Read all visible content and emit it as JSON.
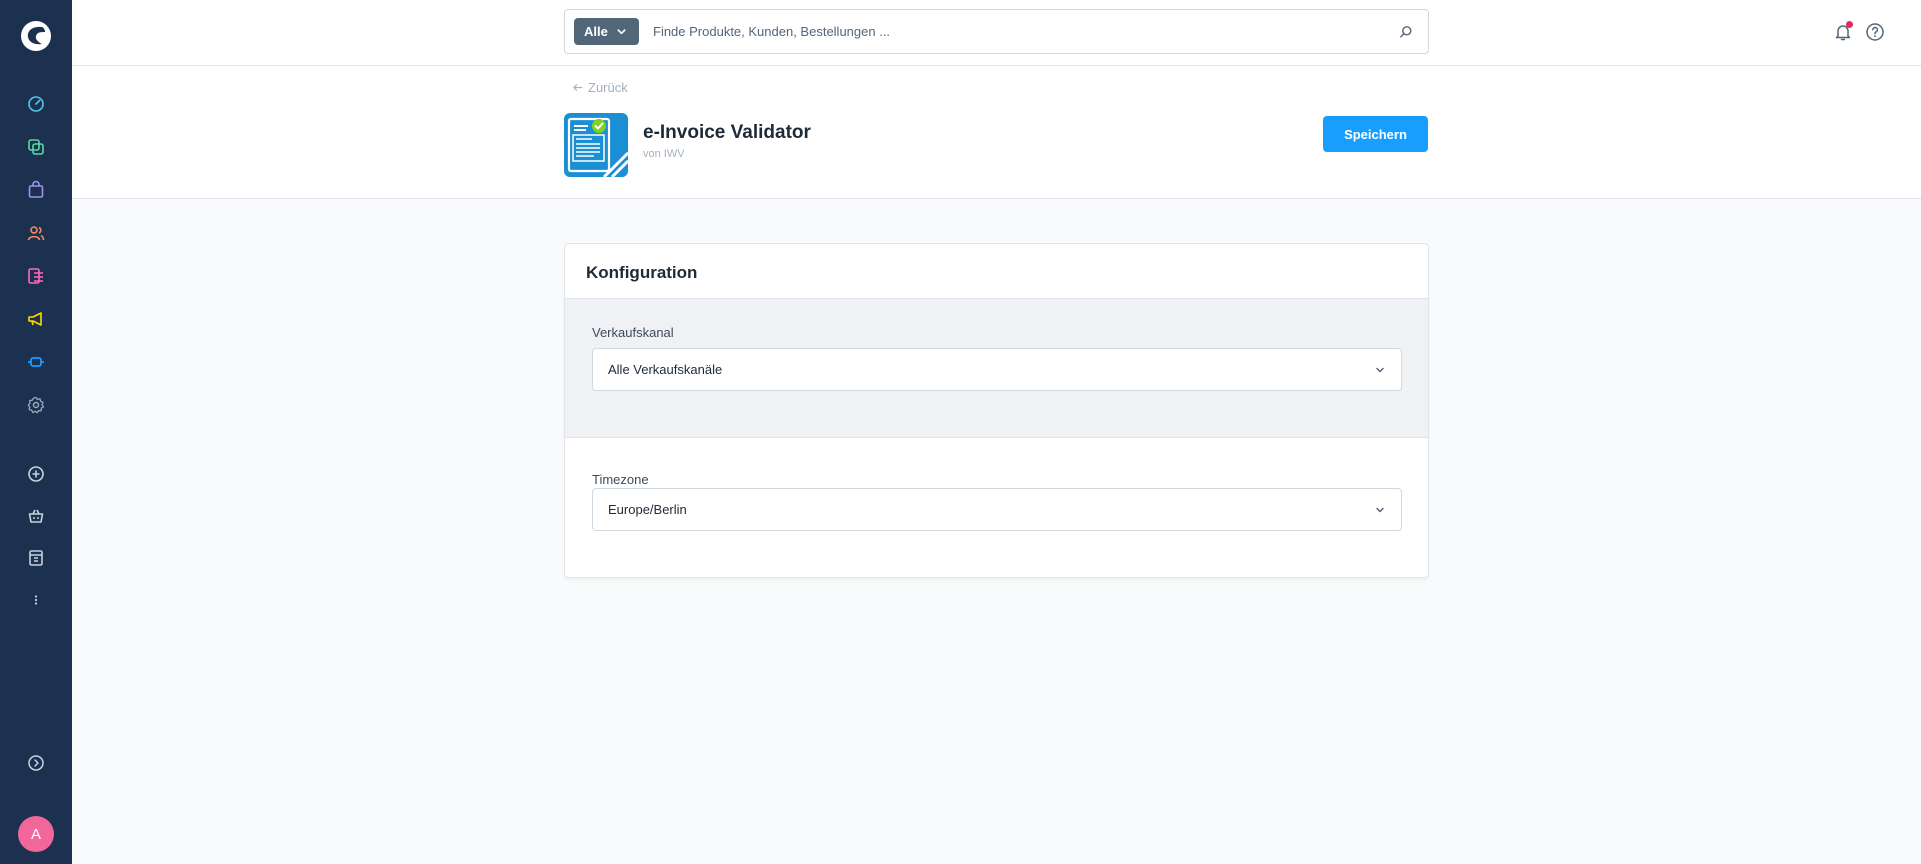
{
  "colors": {
    "sidebar_bg": "#1c3150",
    "primary": "#189eff",
    "avatar_bg": "#f2679a",
    "notification": "#e3285a"
  },
  "sidebar": {
    "logo_icon": "shopware-logo-icon",
    "items": [
      {
        "icon": "dashboard-icon"
      },
      {
        "icon": "catalogues-icon"
      },
      {
        "icon": "orders-icon"
      },
      {
        "icon": "customers-icon"
      },
      {
        "icon": "content-icon"
      },
      {
        "icon": "marketing-icon"
      },
      {
        "icon": "extensions-icon"
      },
      {
        "icon": "settings-icon"
      },
      {
        "icon": "add-sales-channel-icon"
      },
      {
        "icon": "storefront-icon"
      },
      {
        "icon": "headless-icon"
      },
      {
        "icon": "more-icon"
      },
      {
        "icon": "collapse-icon"
      }
    ],
    "avatar_initial": "A"
  },
  "header": {
    "search_type": "Alle",
    "search_placeholder": "Finde Produkte, Kunden, Bestellungen ...",
    "search_value": ""
  },
  "page": {
    "back_label": "Zurück",
    "app_title": "e-Invoice Validator",
    "app_vendor": "von IWV",
    "save_label": "Speichern"
  },
  "card": {
    "title": "Konfiguration",
    "sales_channel": {
      "label": "Verkaufskanal",
      "value": "Alle Verkaufskanäle"
    },
    "timezone": {
      "label": "Timezone",
      "value": "Europe/Berlin"
    }
  }
}
